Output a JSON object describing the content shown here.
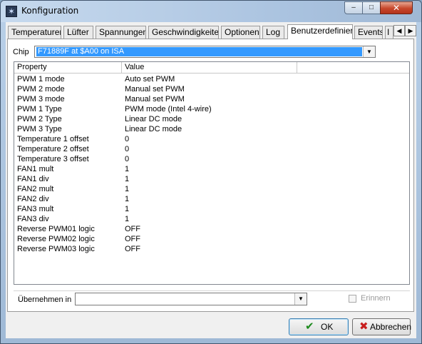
{
  "window": {
    "title": "Konfiguration",
    "minimize_glyph": "–",
    "maximize_glyph": "□",
    "close_glyph": "✕"
  },
  "tabs": [
    {
      "label": "Temperaturen"
    },
    {
      "label": "Lüfter"
    },
    {
      "label": "Spannungen"
    },
    {
      "label": "Geschwindigkeiten"
    },
    {
      "label": "Optionen"
    },
    {
      "label": "Log"
    },
    {
      "label": "Benutzerdefiniert",
      "active": true
    },
    {
      "label": "Events"
    },
    {
      "label": "I"
    }
  ],
  "tab_scroll": {
    "left": "◀",
    "right": "▶"
  },
  "chip": {
    "label": "Chip",
    "value": "F71889F at $A00 on ISA"
  },
  "grid": {
    "headers": {
      "property": "Property",
      "value": "Value"
    },
    "rows": [
      {
        "property": "PWM 1 mode",
        "value": "Auto set PWM"
      },
      {
        "property": "PWM 2 mode",
        "value": "Manual set PWM"
      },
      {
        "property": "PWM 3 mode",
        "value": "Manual set PWM"
      },
      {
        "property": "PWM 1 Type",
        "value": "PWM mode (Intel 4-wire)"
      },
      {
        "property": "PWM 2 Type",
        "value": "Linear DC mode"
      },
      {
        "property": "PWM 3 Type",
        "value": "Linear DC mode"
      },
      {
        "property": "Temperature 1 offset",
        "value": "0"
      },
      {
        "property": "Temperature 2 offset",
        "value": "0"
      },
      {
        "property": "Temperature 3 offset",
        "value": "0"
      },
      {
        "property": "FAN1 mult",
        "value": "1"
      },
      {
        "property": "FAN1 div",
        "value": "1"
      },
      {
        "property": "FAN2 mult",
        "value": "1"
      },
      {
        "property": "FAN2 div",
        "value": "1"
      },
      {
        "property": "FAN3 mult",
        "value": "1"
      },
      {
        "property": "FAN3 div",
        "value": "1"
      },
      {
        "property": "Reverse PWM01 logic",
        "value": "OFF"
      },
      {
        "property": "Reverse PWM02 logic",
        "value": "OFF"
      },
      {
        "property": "Reverse PWM03 logic",
        "value": "OFF"
      }
    ]
  },
  "apply": {
    "label": "Übernehmen in",
    "value": "",
    "remember_label": "Erinnern",
    "remember_checked": false
  },
  "buttons": {
    "ok_label": "OK",
    "cancel_label": "Abbrechen"
  },
  "icons": {
    "dropdown": "▼",
    "ok_check": "✔",
    "cancel_x": "✖",
    "app": "✶"
  },
  "colors": {
    "selection": "#3399ff",
    "close_button": "#c7472b",
    "ok_icon": "#1d8a1d",
    "cancel_icon": "#c81e1e"
  }
}
